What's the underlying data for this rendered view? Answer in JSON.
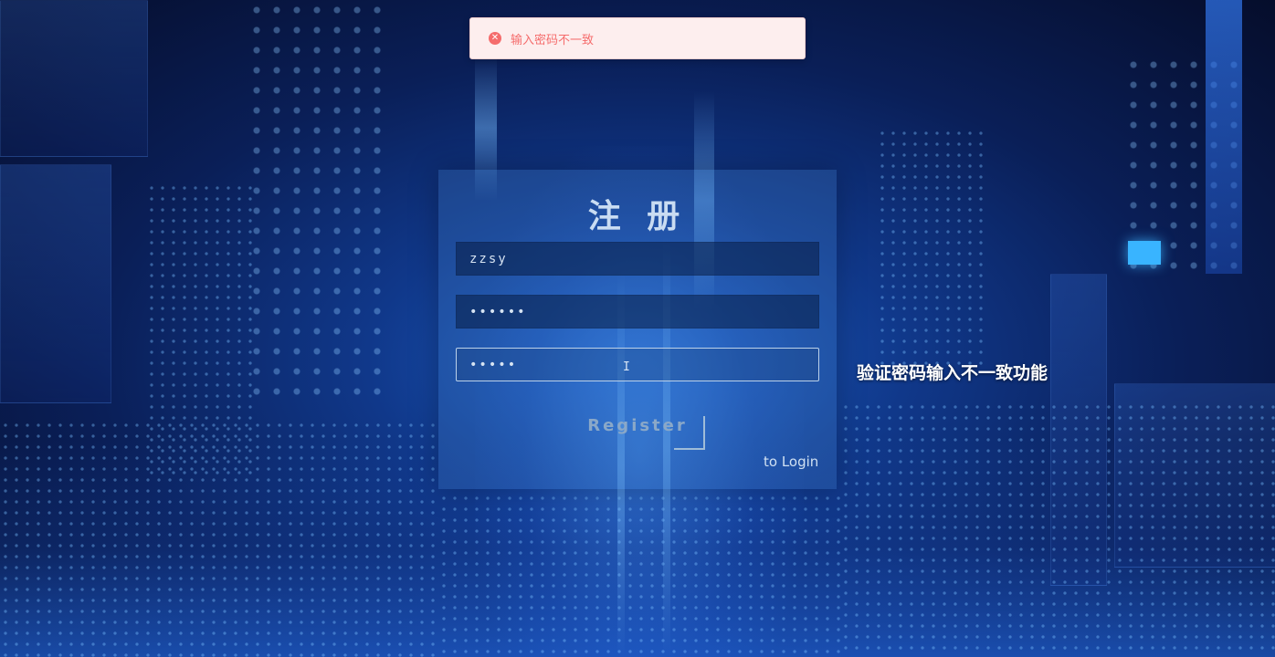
{
  "toast": {
    "icon": "close-circle-icon",
    "message": "输入密码不一致",
    "color": "#f56c6c"
  },
  "register_form": {
    "title": "注 册",
    "username_value": "zzsy",
    "password_value": "••••••",
    "confirm_password_value": "•••••",
    "text_cursor": "I",
    "register_button_label": "Register",
    "login_link_label": "to Login"
  },
  "caption": "验证密码输入不一致功能",
  "colors": {
    "background": "#0a1f58",
    "card": "#4682c8",
    "accent": "#39b4ff"
  }
}
